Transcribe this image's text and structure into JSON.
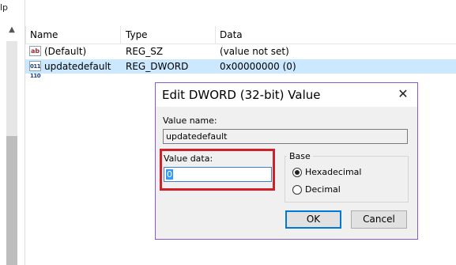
{
  "tree_pane": {
    "fragment_text": "lp"
  },
  "list": {
    "headers": {
      "name": "Name",
      "type": "Type",
      "data": "Data"
    },
    "rows": [
      {
        "icon": "ab",
        "name": "(Default)",
        "type": "REG_SZ",
        "data": "(value not set)"
      },
      {
        "icon": "011 110",
        "name": "updatedefault",
        "type": "REG_DWORD",
        "data": "0x00000000 (0)"
      }
    ]
  },
  "dialog": {
    "title": "Edit DWORD (32-bit) Value",
    "close_glyph": "✕",
    "value_name_label": "Value name:",
    "value_name": "updatedefault",
    "value_data_label": "Value data:",
    "value_data": "0",
    "base_label": "Base",
    "hex_label": "Hexadecimal",
    "dec_label": "Decimal",
    "ok_label": "OK",
    "cancel_label": "Cancel"
  },
  "colors": {
    "selection": "#cce8ff",
    "highlight_border": "#d0202a",
    "dialog_border": "#8a5bc7",
    "focus_blue": "#0078d7"
  }
}
